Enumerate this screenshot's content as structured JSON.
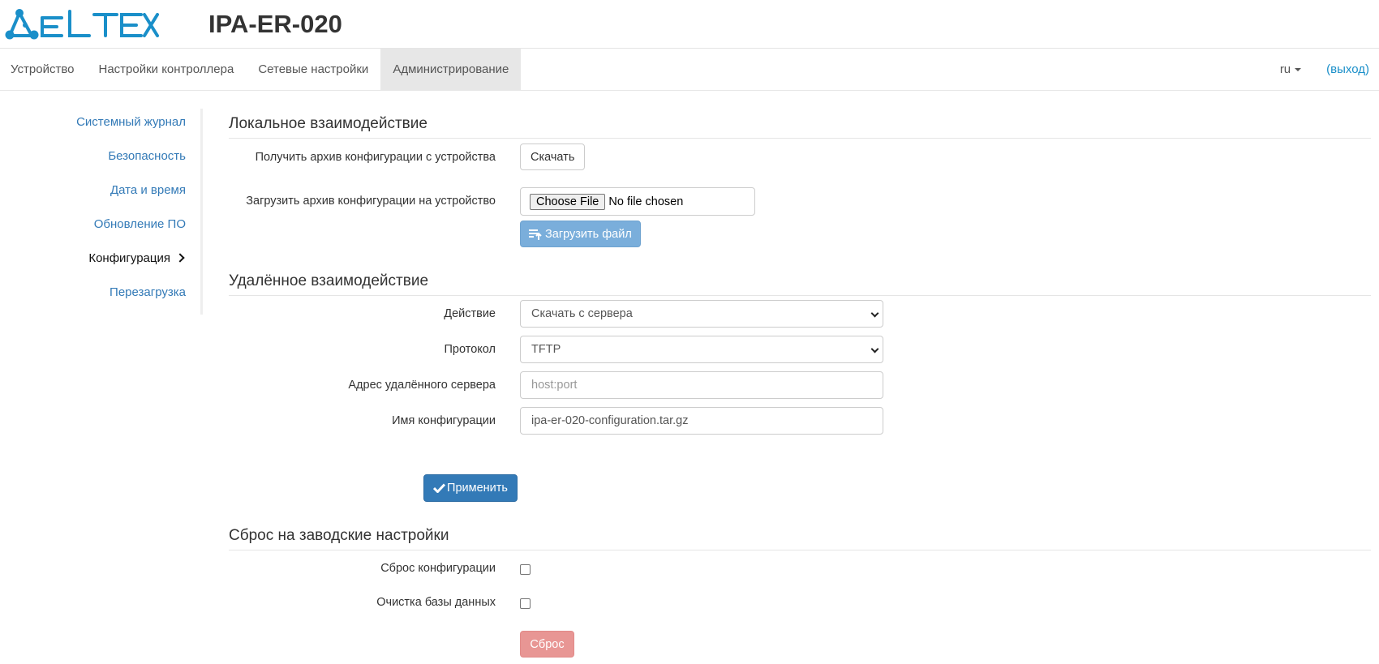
{
  "header": {
    "brand": "ELTEX",
    "device_title": "IPA-ER-020"
  },
  "nav": {
    "tabs": [
      {
        "label": "Устройство"
      },
      {
        "label": "Настройки контроллера"
      },
      {
        "label": "Сетевые настройки"
      },
      {
        "label": "Администрирование",
        "active": true
      }
    ],
    "language": "ru",
    "logout": "(выход)"
  },
  "sidebar": {
    "items": [
      {
        "label": "Системный журнал"
      },
      {
        "label": "Безопасность"
      },
      {
        "label": "Дата и время"
      },
      {
        "label": "Обновление ПО"
      },
      {
        "label": "Конфигурация",
        "active": true
      },
      {
        "label": "Перезагрузка"
      }
    ]
  },
  "local": {
    "title": "Локальное взаимодействие",
    "download_label": "Получить архив конфигурации с устройства",
    "download_button": "Скачать",
    "upload_label": "Загрузить архив конфигурации на устройство",
    "choose_file": "Choose File",
    "no_file": "No file chosen",
    "upload_button": "Загрузить файл"
  },
  "remote": {
    "title": "Удалённое взаимодействие",
    "action_label": "Действие",
    "action_value": "Скачать с сервера",
    "protocol_label": "Протокол",
    "protocol_value": "TFTP",
    "server_label": "Адрес удалённого сервера",
    "server_placeholder": "host:port",
    "config_label": "Имя конфигурации",
    "config_value": "ipa-er-020-configuration.tar.gz",
    "apply_button": "Применить"
  },
  "reset": {
    "title": "Сброс на заводские настройки",
    "config_reset_label": "Сброс конфигурации",
    "db_clear_label": "Очистка базы данных",
    "reset_button": "Сброс"
  },
  "colors": {
    "brand": "#1a8fc9",
    "link": "#337ab7",
    "primary": "#337ab7",
    "danger": "#e89694"
  }
}
